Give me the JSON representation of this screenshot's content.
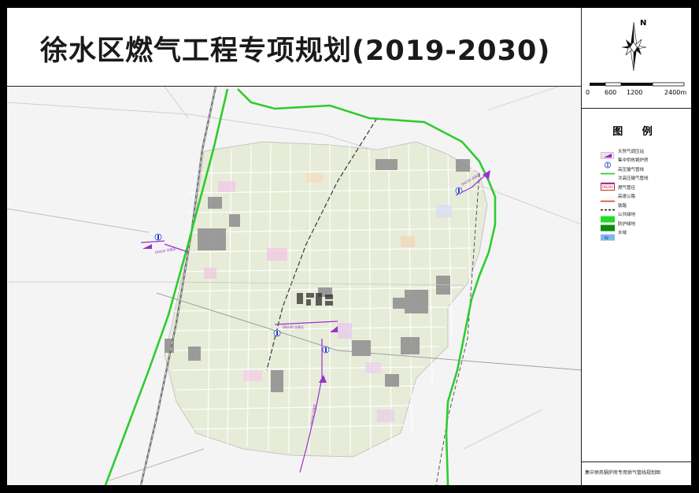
{
  "title": "徐水区燃气工程专项规划(2019-2030)",
  "north": {
    "label": "N"
  },
  "scale_bar": {
    "ticks": [
      "0",
      "600",
      "1200",
      "2400m"
    ]
  },
  "legend": {
    "title": "图 例",
    "items": [
      {
        "symbol": "regulator-station",
        "label": "天然气调压站",
        "color": "#a020c0"
      },
      {
        "symbol": "boiler-room",
        "label": "集中供热锅炉房",
        "color": "#2040c0"
      },
      {
        "symbol": "hp-pipeline",
        "label": "高压输气管线",
        "color": "#2ecc2e"
      },
      {
        "symbol": "sub-hp-pipeline",
        "label": "次高压输气管线",
        "color": "#9a30d0"
      },
      {
        "symbol": "pipe-diameter",
        "label": "燃气管径",
        "color": "#c03030",
        "badge": "DN200"
      },
      {
        "symbol": "expressway",
        "label": "高速公路",
        "color": "#e03030"
      },
      {
        "symbol": "railway",
        "label": "铁路",
        "color": "#111111"
      },
      {
        "symbol": "public-green",
        "label": "公共绿地",
        "color": "#22dd22"
      },
      {
        "symbol": "protective-green",
        "label": "防护绿地",
        "color": "#118811"
      },
      {
        "symbol": "water",
        "label": "水域",
        "color": "#7fb7ee"
      }
    ]
  },
  "footer": {
    "note": "集中供热锅炉房专用供气管线规划图"
  },
  "map": {
    "boundary_color": "#2ecc2e",
    "pipeline_color": "#9a30d0",
    "stations": [
      {
        "name": "regulator-station-west",
        "label": "DN200 次高压"
      },
      {
        "name": "regulator-station-northeast",
        "label": "DN200 次高压"
      },
      {
        "name": "regulator-station-center",
        "label": "DN200 次高压"
      },
      {
        "name": "regulator-station-south",
        "label": "DN200 次高压"
      }
    ]
  }
}
